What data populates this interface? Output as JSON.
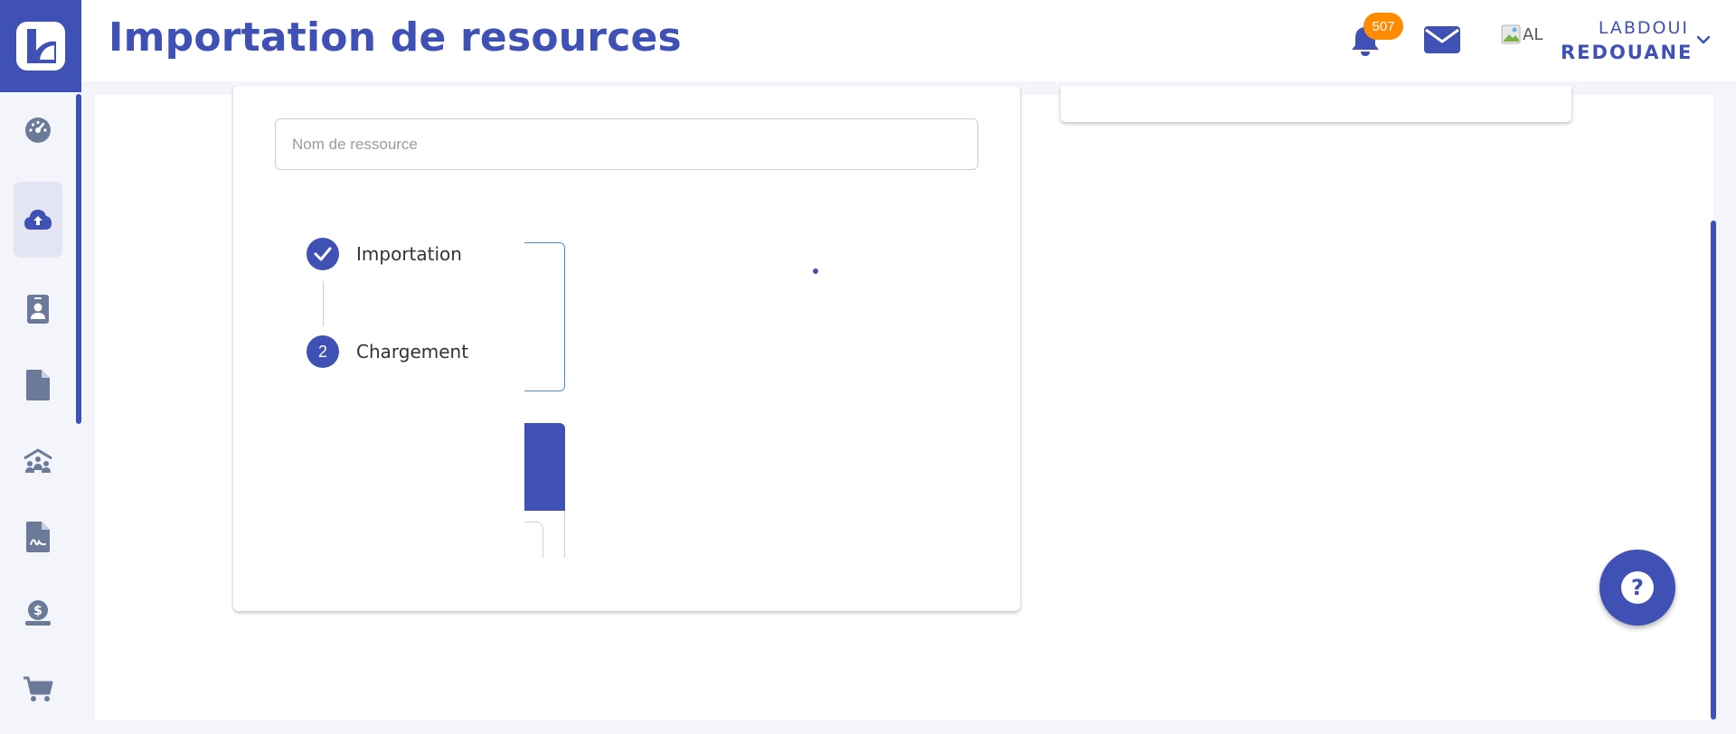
{
  "header": {
    "title": "Importation de resources",
    "notification_count": "507",
    "user": {
      "avatar_alt": "AL",
      "first_name": "LABDOUI",
      "last_name": "REDOUANE"
    }
  },
  "sidebar": {
    "items": [
      {
        "name": "dashboard",
        "icon": "speedometer-icon",
        "active": false
      },
      {
        "name": "import-resources",
        "icon": "cloud-upload-icon",
        "active": true
      },
      {
        "name": "contacts",
        "icon": "id-badge-icon",
        "active": false
      },
      {
        "name": "documents",
        "icon": "file-icon",
        "active": false
      },
      {
        "name": "organization",
        "icon": "people-roof-icon",
        "active": false
      },
      {
        "name": "signed-files",
        "icon": "file-signature-icon",
        "active": false
      },
      {
        "name": "billing",
        "icon": "money-hand-icon",
        "active": false
      },
      {
        "name": "shop",
        "icon": "shopping-cart-icon",
        "active": false
      }
    ]
  },
  "form": {
    "resource_name": {
      "value": "",
      "placeholder": "Nom de ressource"
    }
  },
  "stepper": {
    "steps": [
      {
        "label": "Importation",
        "status": "completed"
      },
      {
        "number": "2",
        "label": "Chargement",
        "status": "active"
      }
    ]
  },
  "help": {
    "symbol": "?"
  },
  "colors": {
    "primary": "#3f51b5",
    "badge": "#ff8c00",
    "icon": "#6b7a99",
    "background": "#f4f5fa"
  }
}
